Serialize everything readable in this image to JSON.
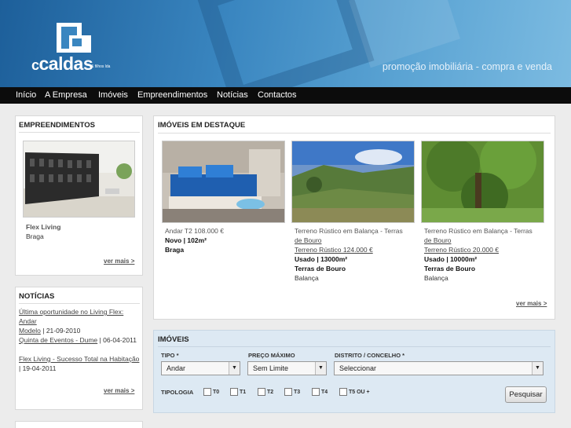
{
  "brand": {
    "name": "caldas",
    "prefix": "c",
    "suffix": "& filhos lda",
    "tagline": "promoção imobiliária - compra e venda"
  },
  "nav": [
    "Início",
    "A Empresa",
    "Imóveis",
    "Empreendimentos",
    "Notícias",
    "Contactos"
  ],
  "empreendimentos": {
    "title": "EMPREENDIMENTOS",
    "name": "Flex Living",
    "location": "Braga",
    "more": "ver mais >"
  },
  "noticias": {
    "title": "NOTÍCIAS",
    "items": [
      {
        "link1": "Última oportunidade no Living Flex: Andar",
        "link2": "Modelo",
        "date": " | 21-09-2010"
      },
      {
        "link1": "Quinta de Eventos - Dume",
        "date": " | 06-04-2011"
      },
      {
        "link1": "Flex Living - Sucesso Total na Habitação",
        "date": " | 19-04-2011"
      }
    ],
    "more": "ver mais >"
  },
  "destaque": {
    "title": "IMÓVEIS EM DESTAQUE",
    "items": [
      {
        "t1": "Andar T2 108.000 €",
        "t2": "",
        "t3": "",
        "spec": "Novo | 102m²",
        "place": "Braga",
        "sub": ""
      },
      {
        "t1": "Terreno Rústico em Balança - Terras",
        "t2": "de Bouro",
        "t3": "Terreno Rústico 124.000 €",
        "spec": "Usado | 13000m²",
        "place": "Terras de Bouro",
        "sub": "Balança"
      },
      {
        "t1": "Terreno Rústico em Balança - Terras",
        "t2": "de Bouro",
        "t3": "Terreno Rústico 20.000 €",
        "spec": "Usado | 10000m²",
        "place": "Terras de Bouro",
        "sub": "Balança"
      }
    ],
    "more": "ver mais >"
  },
  "search": {
    "title": "IMÓVEIS",
    "tipo_label": "TIPO *",
    "tipo_value": "Andar",
    "preco_label": "PREÇO MÁXIMO",
    "preco_value": "Sem Limite",
    "distrito_label": "DISTRITO / CONCELHO *",
    "distrito_value": "Seleccionar",
    "tipologia_label": "TIPOLOGIA",
    "tipologias": [
      "T0",
      "T1",
      "T2",
      "T3",
      "T4",
      "T5 OU +"
    ],
    "button": "Pesquisar"
  },
  "colors": {
    "header": "#2e78b5",
    "nav": "#0c0c0c",
    "search_bg": "#dde9f3"
  }
}
